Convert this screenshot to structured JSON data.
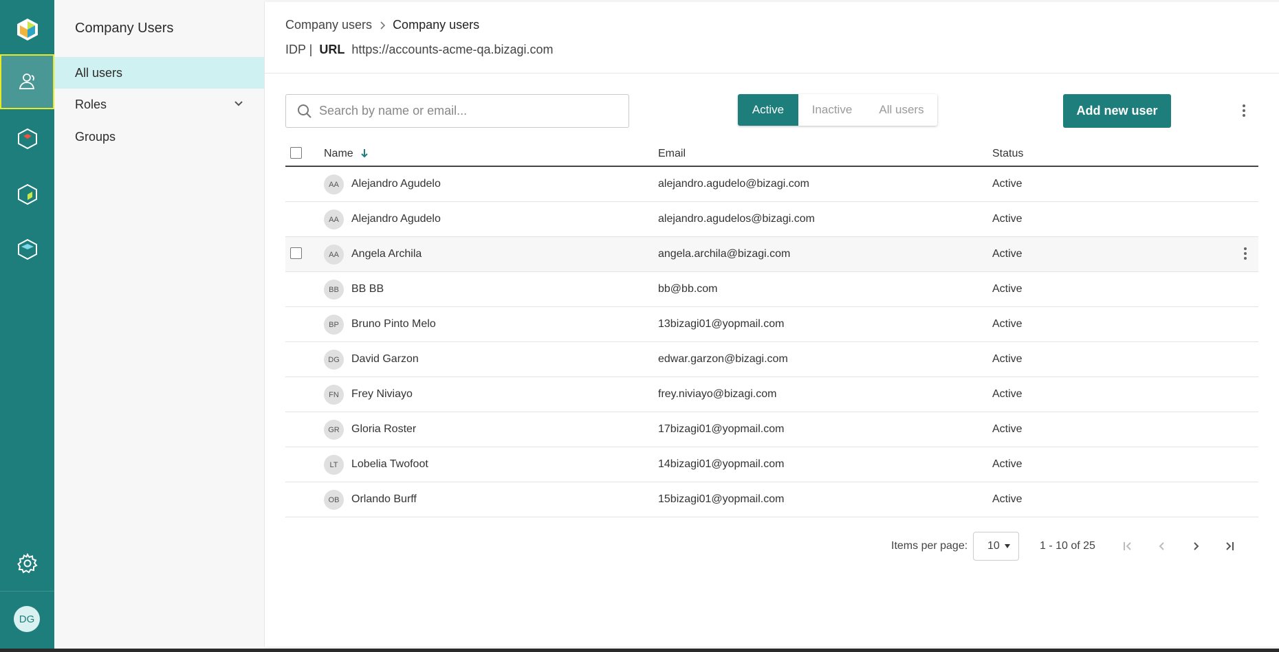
{
  "colors": {
    "teal": "#1e7e7c",
    "highlight": "#e7ea24",
    "selected_nav": "#d0f1f1"
  },
  "rail": {
    "icons": [
      "logo-icon",
      "users-icon",
      "product-icon-1",
      "product-icon-2",
      "product-icon-3",
      "gear-icon"
    ],
    "avatar_initials": "DG"
  },
  "sidebar": {
    "title": "Company Users",
    "items": [
      {
        "label": "All users"
      },
      {
        "label": "Roles"
      },
      {
        "label": "Groups"
      }
    ]
  },
  "header": {
    "breadcrumb_parent": "Company users",
    "breadcrumb_current": "Company users",
    "idp_label": "IDP |",
    "url_label": "URL",
    "url_value": "https://accounts-acme-qa.bizagi.com"
  },
  "toolbar": {
    "search_placeholder": "Search by name or email...",
    "filters": {
      "active": "Active",
      "inactive": "Inactive",
      "all": "All users"
    },
    "selected_filter": "Active",
    "add_label": "Add new user"
  },
  "table": {
    "columns": {
      "name": "Name",
      "email": "Email",
      "status": "Status"
    },
    "sort_column": "Name",
    "rows": [
      {
        "initials": "AA",
        "name": "Alejandro Agudelo",
        "email": "alejandro.agudelo@bizagi.com",
        "status": "Active"
      },
      {
        "initials": "AA",
        "name": "Alejandro Agudelo",
        "email": "alejandro.agudelos@bizagi.com",
        "status": "Active"
      },
      {
        "initials": "AA",
        "name": "Angela Archila",
        "email": "angela.archila@bizagi.com",
        "status": "Active"
      },
      {
        "initials": "BB",
        "name": "BB BB",
        "email": "bb@bb.com",
        "status": "Active"
      },
      {
        "initials": "BP",
        "name": "Bruno Pinto Melo",
        "email": "13bizagi01@yopmail.com",
        "status": "Active"
      },
      {
        "initials": "DG",
        "name": "David Garzon",
        "email": "edwar.garzon@bizagi.com",
        "status": "Active"
      },
      {
        "initials": "FN",
        "name": "Frey Niviayo",
        "email": "frey.niviayo@bizagi.com",
        "status": "Active"
      },
      {
        "initials": "GR",
        "name": "Gloria Roster",
        "email": "17bizagi01@yopmail.com",
        "status": "Active"
      },
      {
        "initials": "LT",
        "name": "Lobelia Twofoot",
        "email": "14bizagi01@yopmail.com",
        "status": "Active"
      },
      {
        "initials": "OB",
        "name": "Orlando Burff",
        "email": "15bizagi01@yopmail.com",
        "status": "Active"
      }
    ]
  },
  "pagination": {
    "items_per_page_label": "Items per page:",
    "items_per_page": "10",
    "range": "1 - 10 of 25"
  }
}
